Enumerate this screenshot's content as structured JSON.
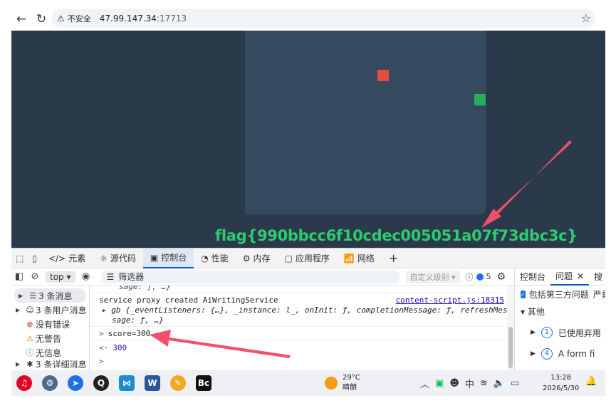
{
  "browser": {
    "insecure_label": "不安全",
    "host": "47.99.147.34",
    "port": ":17713"
  },
  "page": {
    "flag_text": "flag{990bbcc6f10cdec005051a07f73dbc3c}",
    "colors": {
      "background": "#2b3a4a",
      "game": "#354a5f",
      "red_block": "#e74c3c",
      "green_block": "#27ae60",
      "flag": "#2ecc71"
    }
  },
  "devtools": {
    "tabs": [
      {
        "icon": "</>",
        "label": "元素"
      },
      {
        "icon": "☼",
        "label": "源代码"
      },
      {
        "icon": "▣",
        "label": "控制台"
      },
      {
        "icon": "◔",
        "label": "性能"
      },
      {
        "icon": "⚙",
        "label": "内存"
      },
      {
        "icon": "▢",
        "label": "应用程序"
      },
      {
        "icon": "📶",
        "label": "网络"
      }
    ],
    "filter": {
      "context": "top ▾",
      "placeholder": "筛选器",
      "levels": "自定义级别 ▾",
      "issue_count": "5"
    },
    "sidebar": [
      {
        "label": "3 条消息"
      },
      {
        "label": "3 条用户消息"
      },
      {
        "label": "没有错误"
      },
      {
        "label": "无警告"
      },
      {
        "label": "无信息"
      },
      {
        "label": "3 条详细消息"
      }
    ],
    "console": {
      "partial_top": "sage: ƒ, …}",
      "log_text": "service proxy created AiWritingService",
      "log_source": "content-script.js:18315",
      "object_line1": "▸ gb {_eventListeners: {…}, _instance: l_, onInit: ƒ, completionMessage: ƒ, refreshMes",
      "object_line2": "sage: ƒ, …}",
      "command_prefix": ">",
      "command": "score=300",
      "result_prefix": "<·",
      "result": "300",
      "prompt": ">"
    },
    "issues": {
      "tab_console": "控制台",
      "tab_issues": "问题",
      "tab_more": "搜",
      "include_third_party": "包括第三方问题",
      "severity": "严重",
      "group_other": "▾ 其他",
      "items": [
        {
          "count": "1",
          "label": "已使用弃用"
        },
        {
          "count": "4",
          "label": "A form fi"
        }
      ]
    }
  },
  "taskbar": {
    "weather_temp": "29°C",
    "weather_desc": "晴朗",
    "ime": "中",
    "time": "13:28",
    "date": "2026/5/30"
  }
}
